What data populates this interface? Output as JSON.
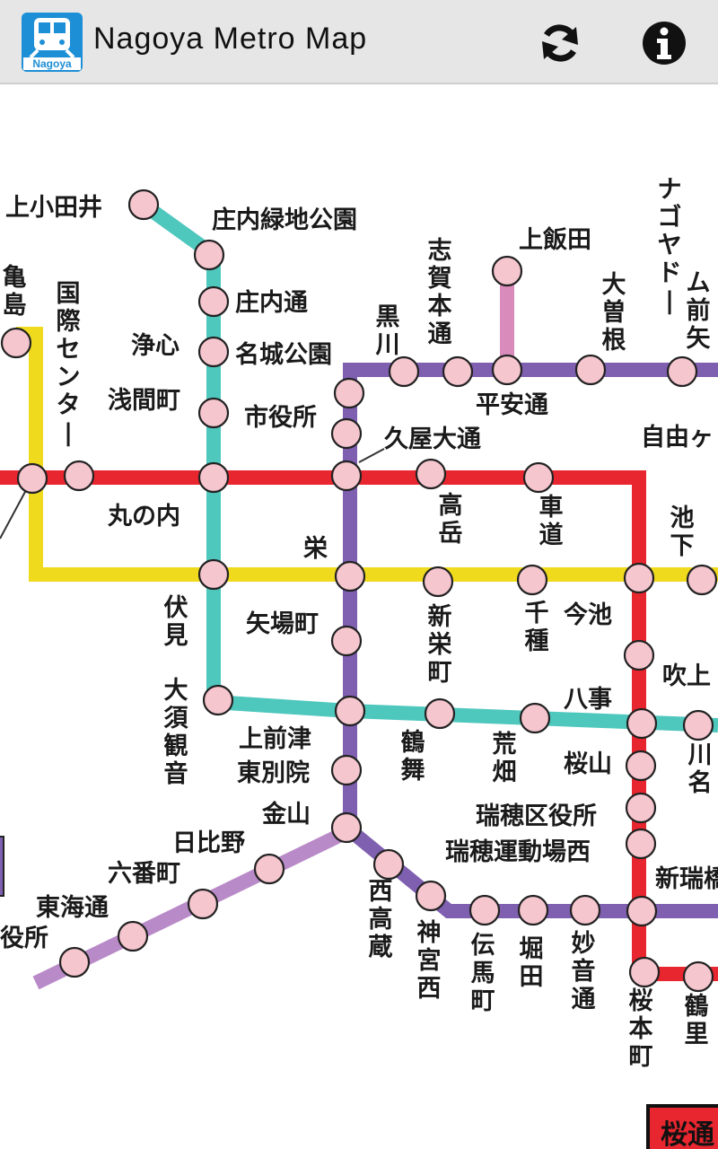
{
  "app": {
    "title": "Nagoya Metro Map",
    "logo_text": "Nagoya"
  },
  "toolbar": {
    "refresh_icon": "refresh-icon",
    "info_icon": "info-icon"
  },
  "colors": {
    "appbar": "#e6e6e6",
    "higashiyama": "#f0da1e",
    "meijo": "#7f5fb0",
    "tsurumai": "#4ec7bd",
    "sakuradori": "#e8262f",
    "kamiiida": "#d98bbb",
    "meiko": "#b98ac8",
    "station": "#f6c6cf"
  },
  "stations": {
    "kamiotai": "上小田井",
    "shonai_ryokuchi": "庄内緑地公園",
    "shonai_dori": "庄内通",
    "joshin": "浄心",
    "meijo_koen": "名城公園",
    "sengencho": "浅間町",
    "shiyakusho": "市役所",
    "hisaya_odori": "久屋大通",
    "kameshima": "亀島",
    "kokusai_center": "国際センター",
    "marunouchi": "丸の内",
    "sakae": "栄",
    "takaoka": "高岳",
    "kurumamichi": "車道",
    "ikeshita": "池下",
    "kurokawa": "黒川",
    "shiga_hondori": "志賀本通",
    "kamiiida": "上飯田",
    "heian_dori": "平安通",
    "ozone": "大曽根",
    "nagoya_dome_mae_yada": "ナゴヤドーム前矢田",
    "jiyugaoka": "自由ヶ",
    "fushimi": "伏見",
    "yabacho": "矢場町",
    "shinsakae": "新栄町",
    "chikusa": "千種",
    "imaike": "今池",
    "fukiage": "吹上",
    "osu_kannon": "大須観音",
    "kamimaezu": "上前津",
    "tsurumai": "鶴舞",
    "arahata": "荒畑",
    "gokiso": "八事",
    "kawana": "川名",
    "higashi_betsuin": "東別院",
    "sakurayama": "桜山",
    "kanayama": "金山",
    "mizuho_kuyakusho": "瑞穂区役所",
    "mizuho_undojo_nishi": "瑞穂運動場西",
    "hibino": "日比野",
    "rokubancho": "六番町",
    "tokai_dori": "東海通",
    "minato_kuyakusho": "役所",
    "nishi_takakura": "西高蔵",
    "jingu_nishi": "神宮西",
    "temmacho": "伝馬町",
    "horita": "堀田",
    "myoon_dori": "妙音通",
    "shin_mizuho": "新瑞橋",
    "sakuramotomachi": "桜本町",
    "tsurusato": "鶴里",
    "sign": "桜通"
  }
}
